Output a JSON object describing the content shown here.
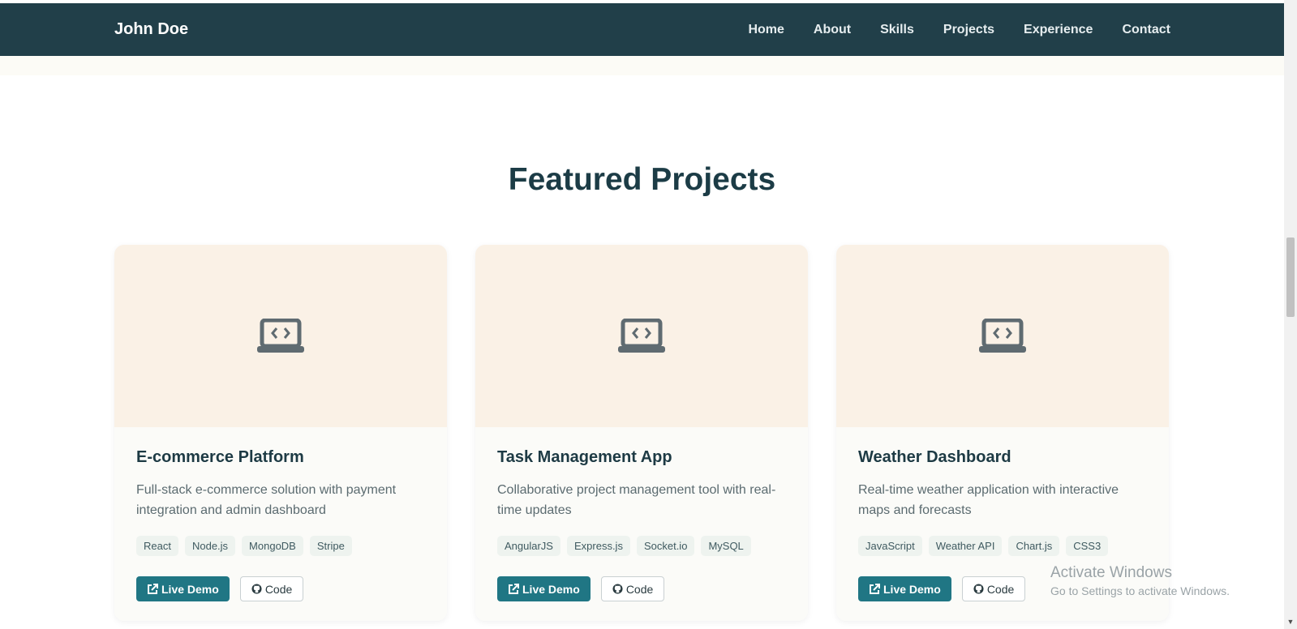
{
  "navbar": {
    "brand": "John Doe",
    "links": [
      "Home",
      "About",
      "Skills",
      "Projects",
      "Experience",
      "Contact"
    ]
  },
  "section": {
    "title": "Featured Projects"
  },
  "projects": [
    {
      "icon": "laptop-code-icon",
      "title": "E-commerce Platform",
      "description": "Full-stack e-commerce solution with payment integration and admin dashboard",
      "tags": [
        "React",
        "Node.js",
        "MongoDB",
        "Stripe"
      ],
      "demo_label": "Live Demo",
      "code_label": "Code"
    },
    {
      "icon": "laptop-code-icon",
      "title": "Task Management App",
      "description": "Collaborative project management tool with real-time updates",
      "tags": [
        "AngularJS",
        "Express.js",
        "Socket.io",
        "MySQL"
      ],
      "demo_label": "Live Demo",
      "code_label": "Code"
    },
    {
      "icon": "laptop-code-icon",
      "title": "Weather Dashboard",
      "description": "Real-time weather application with interactive maps and forecasts",
      "tags": [
        "JavaScript",
        "Weather API",
        "Chart.js",
        "CSS3"
      ],
      "demo_label": "Live Demo",
      "code_label": "Code"
    }
  ],
  "watermark": {
    "title": "Activate Windows",
    "subtitle": "Go to Settings to activate Windows."
  },
  "colors": {
    "navbar_bg": "#213f49",
    "accent": "#207684",
    "card_media_bg": "#faf1e6"
  }
}
